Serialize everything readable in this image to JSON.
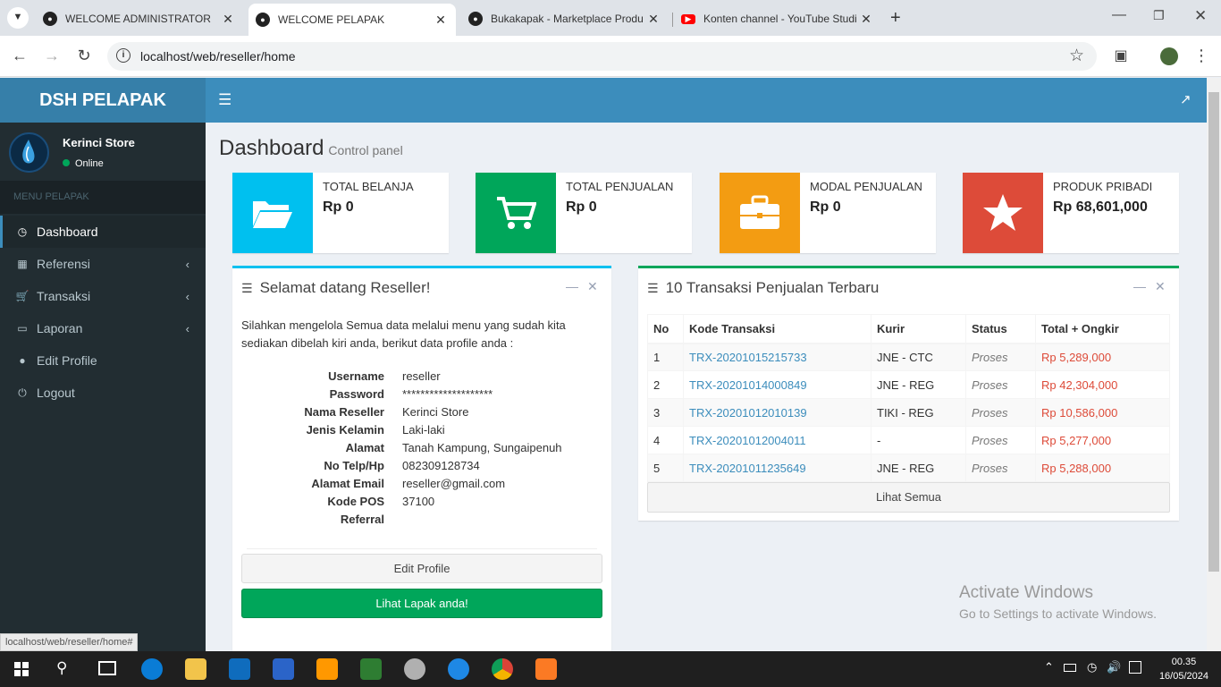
{
  "browser": {
    "tabs": [
      {
        "title": "WELCOME ADMINISTRATOR",
        "active": false
      },
      {
        "title": "WELCOME PELAPAK",
        "active": true
      },
      {
        "title": "Bukakapak - Marketplace Produ",
        "active": false
      },
      {
        "title": "Konten channel - YouTube Studi",
        "active": false
      }
    ],
    "url": "localhost/web/reseller/home",
    "status_url": "localhost/web/reseller/home#"
  },
  "app": {
    "brand": "DSH PELAPAK",
    "user": {
      "name": "Kerinci Store",
      "status": "Online"
    },
    "menu_header": "MENU PELAPAK",
    "menu": [
      {
        "label": "Dashboard",
        "icon": "dashboard-icon",
        "active": true,
        "submenu": false
      },
      {
        "label": "Referensi",
        "icon": "th-icon",
        "active": false,
        "submenu": true
      },
      {
        "label": "Transaksi",
        "icon": "cart-icon",
        "active": false,
        "submenu": true
      },
      {
        "label": "Laporan",
        "icon": "book-icon",
        "active": false,
        "submenu": true
      },
      {
        "label": "Edit Profile",
        "icon": "user-icon",
        "active": false,
        "submenu": false
      },
      {
        "label": "Logout",
        "icon": "power-icon",
        "active": false,
        "submenu": false
      }
    ],
    "page_title": "Dashboard",
    "page_subtitle": "Control panel",
    "info_boxes": [
      {
        "label": "TOTAL BELANJA",
        "value": "Rp 0",
        "color": "#00c0ef",
        "icon": "folder-open-icon"
      },
      {
        "label": "TOTAL PENJUALAN",
        "value": "Rp 0",
        "color": "#00a65a",
        "icon": "cart-icon"
      },
      {
        "label": "MODAL PENJUALAN",
        "value": "Rp 0",
        "color": "#f39c12",
        "icon": "briefcase-icon"
      },
      {
        "label": "PRODUK PRIBADI",
        "value": "Rp 68,601,000",
        "color": "#dd4b39",
        "icon": "star-icon"
      }
    ],
    "welcome": {
      "title": "Selamat datang Reseller!",
      "intro": "Silahkan mengelola Semua data melalui menu yang sudah kita sediakan dibelah kiri anda, berikut data profile anda :",
      "profile": [
        {
          "key": "Username",
          "value": "reseller"
        },
        {
          "key": "Password",
          "value": "********************"
        },
        {
          "key": "Nama Reseller",
          "value": "Kerinci Store"
        },
        {
          "key": "Jenis Kelamin",
          "value": "Laki-laki"
        },
        {
          "key": "Alamat",
          "value": "Tanah Kampung, Sungaipenuh"
        },
        {
          "key": "No Telp/Hp",
          "value": "082309128734"
        },
        {
          "key": "Alamat Email",
          "value": "reseller@gmail.com"
        },
        {
          "key": "Kode POS",
          "value": "37100"
        },
        {
          "key": "Referral",
          "value": ""
        }
      ],
      "edit_button": "Edit Profile",
      "lapak_button": "Lihat Lapak anda!"
    },
    "transactions": {
      "title": "10 Transaksi Penjualan Terbaru",
      "columns": [
        "No",
        "Kode Transaksi",
        "Kurir",
        "Status",
        "Total + Ongkir"
      ],
      "rows": [
        [
          "1",
          "TRX-20201015215733",
          "JNE - CTC",
          "Proses",
          "Rp 5,289,000"
        ],
        [
          "2",
          "TRX-20201014000849",
          "JNE - REG",
          "Proses",
          "Rp 42,304,000"
        ],
        [
          "3",
          "TRX-20201012010139",
          "TIKI - REG",
          "Proses",
          "Rp 10,586,000"
        ],
        [
          "4",
          "TRX-20201012004011",
          "-",
          "Proses",
          "Rp 5,277,000"
        ],
        [
          "5",
          "TRX-20201011235649",
          "JNE - REG",
          "Proses",
          "Rp 5,288,000"
        ]
      ],
      "view_all": "Lihat Semua"
    }
  },
  "watermark": {
    "line1": "Activate Windows",
    "line2": "Go to Settings to activate Windows."
  },
  "taskbar": {
    "time": "00.35",
    "date": "16/05/2024"
  }
}
